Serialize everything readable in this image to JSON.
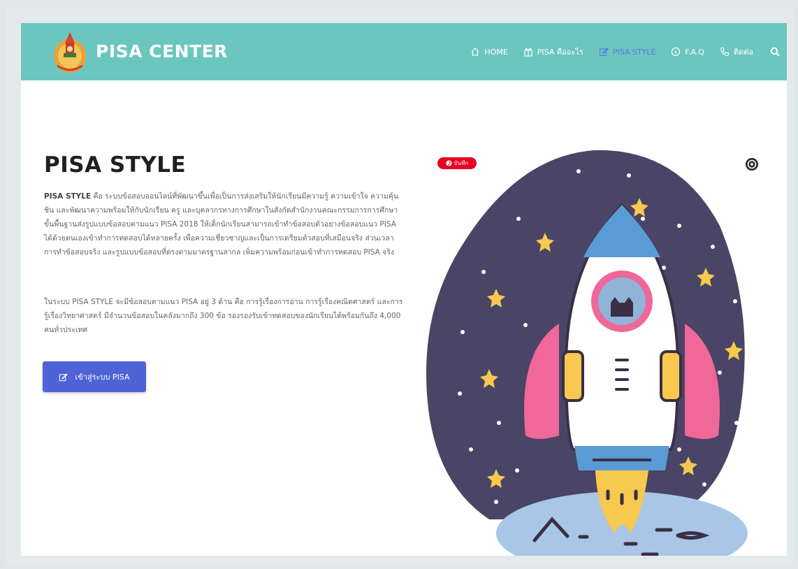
{
  "brand": {
    "name": "PISA CENTER"
  },
  "nav": {
    "items": [
      {
        "label": "HOME",
        "icon": "home-icon",
        "active": false
      },
      {
        "label": "PISA คืออะไร",
        "icon": "gift-icon",
        "active": false
      },
      {
        "label": "PISA STYLE",
        "icon": "edit-icon",
        "active": true
      },
      {
        "label": "F.A.Q",
        "icon": "info-icon",
        "active": false
      },
      {
        "label": "ติดต่อ",
        "icon": "phone-icon",
        "active": false
      }
    ],
    "search_icon": "search-icon"
  },
  "main": {
    "title": "PISA STYLE",
    "para1_lead": "PISA STYLE",
    "para1": "คือ ระบบข้อสอบออนไลน์ที่พัฒนาขึ้นเพื่อเป็นการส่งเสริมให้นักเรียนมีความรู้ ความเข้าใจ ความคุ้นชิน และพัฒนาความพร้อมให้กับนักเรียน ครู และบุคลากรทางการศึกษาในสังกัดสำนักงานคณะกรรมการการศึกษาขั้นพื้นฐานส่งรูปแบบข้อสอบตามแนว PISA 2018 ให้เด็กนักเรียนสามารถเข้าทำข้อสอบตัวอย่างข้อสอบแนว PISA ได้ด้วยตนเองเข้าทำการทดสอบได้หลายครั้ง เพื่อความเชี่ยวชาญและเป็นการเตรียมตัวสอบที่เสมือนจริง ส่วนเวลาการทำข้อสอบจริง และรูปแบบข้อสอบที่ตรงตามมาตรฐานสากล เพิ่มความพร้อมก่อนเข้าทำการทดสอบ PISA จริง",
    "para2": "ในระบบ PISA STYLE จะมีข้อสอบตามแนว PISA อยู่ 3 ด้าน คือ การรู้เรื่องการอ่าน การรู้เรื่องคณิตศาสตร์ และการรู้เรื่องวิทยาศาสตร์ มีจำนวนข้อสอบในคลังมากถึง 300 ข้อ รองรองรับเข้าทดสอบของนักเรียนได้พร้อมกันถึง 4,000 คนทั่วประเทศ",
    "cta_label": "เข้าสู่ระบบ PISA",
    "cta_icon": "edit-icon"
  },
  "image": {
    "save_label": "บันทึก",
    "save_icon": "pinterest-icon",
    "lens_icon": "lens-icon"
  },
  "colors": {
    "navbar": "#6cc6c0",
    "active_nav": "#4e7fe0",
    "cta": "#4f63d6",
    "space": "#4a4466",
    "rocket_blue": "#5b9bd5",
    "rocket_pink": "#f0679a",
    "star": "#f7c94e"
  }
}
